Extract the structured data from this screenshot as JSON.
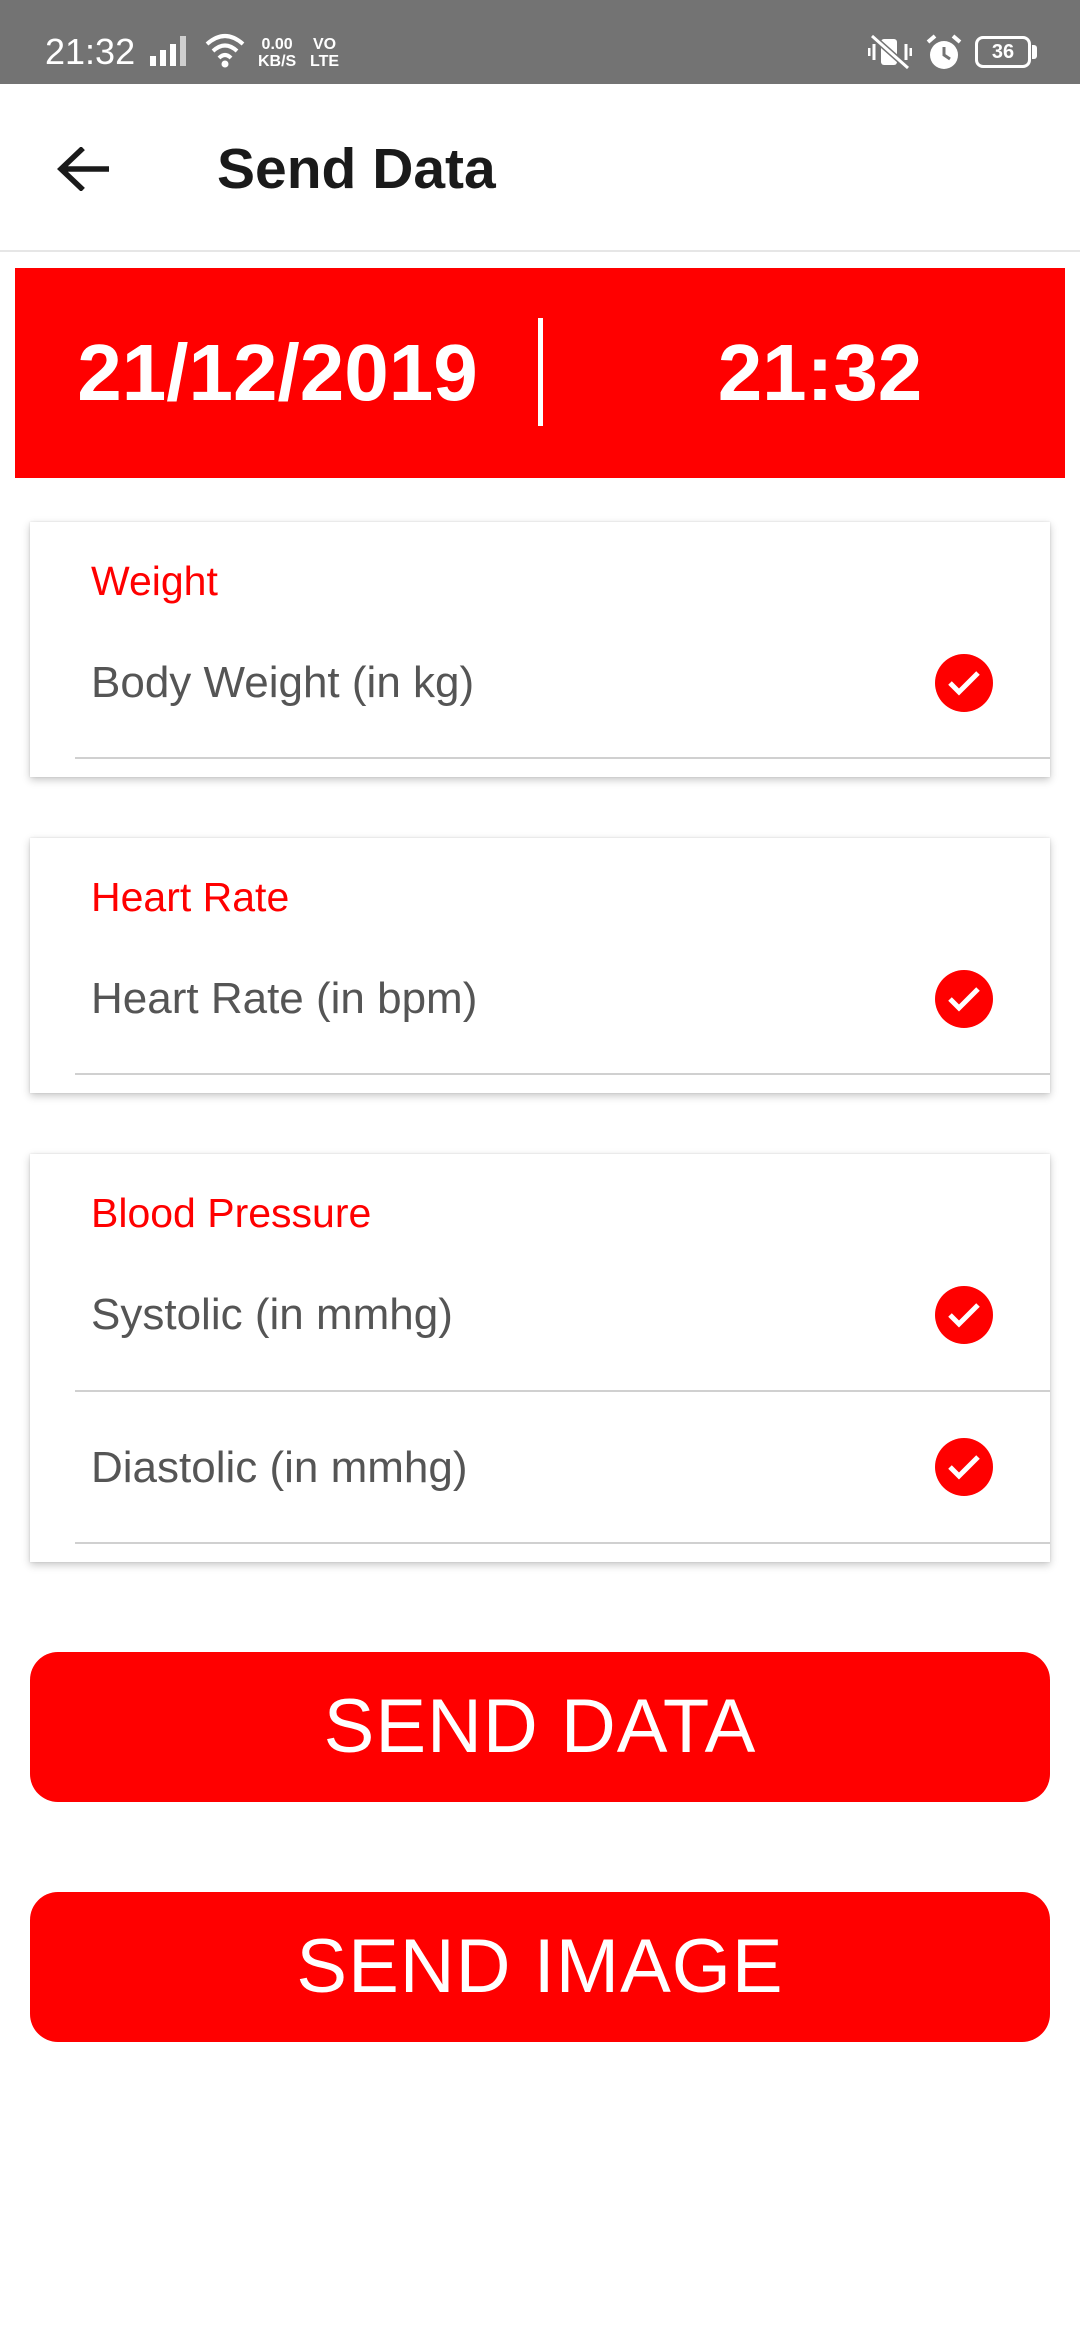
{
  "status_bar": {
    "time": "21:32",
    "speed_value": "0.00",
    "speed_unit": "KB/S",
    "volte_top": "VO",
    "volte_bottom": "LTE",
    "battery": "36"
  },
  "app_bar": {
    "title": "Send Data"
  },
  "banner": {
    "date": "21/12/2019",
    "time": "21:32"
  },
  "cards": {
    "weight": {
      "title": "Weight",
      "rows": [
        {
          "label": "Body Weight (in kg)",
          "checked": true
        }
      ]
    },
    "heart_rate": {
      "title": "Heart Rate",
      "rows": [
        {
          "label": "Heart Rate (in bpm)",
          "checked": true
        }
      ]
    },
    "blood_pressure": {
      "title": "Blood Pressure",
      "rows": [
        {
          "label": "Systolic (in mmhg)",
          "checked": true
        },
        {
          "label": "Diastolic (in mmhg)",
          "checked": true
        }
      ]
    }
  },
  "buttons": {
    "send_data": "SEND DATA",
    "send_image": "SEND IMAGE"
  },
  "colors": {
    "accent": "#ff0000",
    "status_bar": "#737373",
    "label_text": "#555555"
  },
  "icons": [
    "signal-icon",
    "wifi-icon",
    "vibrate-off-icon",
    "alarm-icon",
    "battery-icon",
    "back-arrow-icon",
    "check-circle-icon"
  ]
}
